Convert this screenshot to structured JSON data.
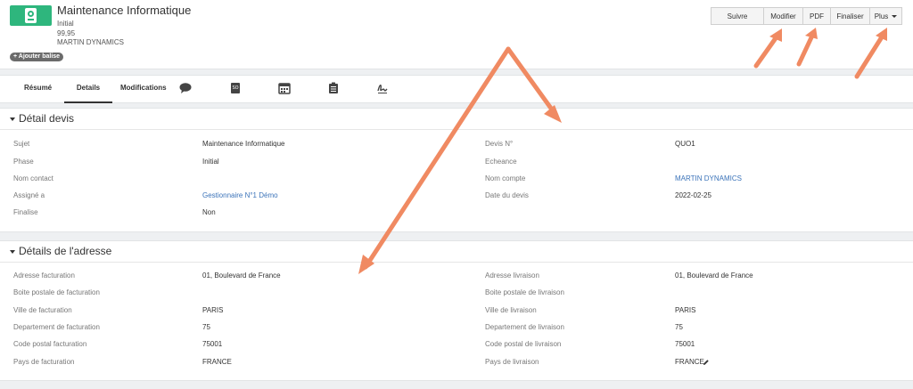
{
  "header": {
    "title": "Maintenance Informatique",
    "sub_lines": [
      "Initial",
      "99,95",
      "MARTIN DYNAMICS"
    ],
    "tag_button": "+ Ajouter balise",
    "logo_icon": "quote-document-icon",
    "logo_color": "#2eb67d"
  },
  "actions": {
    "follow": "Suivre",
    "edit": "Modifier",
    "pdf": "PDF",
    "finalize": "Finaliser",
    "more": "Plus"
  },
  "tabs": {
    "summary": "Résumé",
    "details": "Details",
    "changes": "Modifications",
    "icons": [
      "comment-icon",
      "sales-order-icon",
      "calendar-icon",
      "clipboard-list-icon",
      "signature-icon"
    ]
  },
  "devis": {
    "title": "Détail devis",
    "left": [
      {
        "label": "Sujet",
        "value": "Maintenance Informatique"
      },
      {
        "label": "Phase",
        "value": "Initial"
      },
      {
        "label": "Nom contact",
        "value": ""
      },
      {
        "label": "Assigné a",
        "value": "Gestionnaire N°1 Démo"
      },
      {
        "label": "Finalise",
        "value": "Non"
      }
    ],
    "right": [
      {
        "label": "Devis N°",
        "value": "QUO1"
      },
      {
        "label": "Echeance",
        "value": ""
      },
      {
        "label": "Nom compte",
        "value": "MARTIN DYNAMICS"
      },
      {
        "label": "Date du devis",
        "value": "2022-02-25"
      }
    ]
  },
  "adresse": {
    "title": "Détails de l'adresse",
    "left": [
      {
        "label": "Adresse facturation",
        "value": "01, Boulevard de France"
      },
      {
        "label": "Boite postale de facturation",
        "value": ""
      },
      {
        "label": "Ville de facturation",
        "value": "PARIS"
      },
      {
        "label": "Departement de facturation",
        "value": "75"
      },
      {
        "label": "Code postal facturation",
        "value": "75001"
      },
      {
        "label": "Pays de facturation",
        "value": "FRANCE"
      }
    ],
    "right": [
      {
        "label": "Adresse livraison",
        "value": "01, Boulevard de France"
      },
      {
        "label": "Boite postale de livraison",
        "value": ""
      },
      {
        "label": "Ville de livraison",
        "value": "PARIS"
      },
      {
        "label": "Departement de livraison",
        "value": "75"
      },
      {
        "label": "Code postal de livraison",
        "value": "75001"
      },
      {
        "label": "Pays de livraison",
        "value": "FRANCE"
      }
    ]
  },
  "colors": {
    "link": "#3b73b9",
    "annotation_arrow": "#f08a62"
  }
}
